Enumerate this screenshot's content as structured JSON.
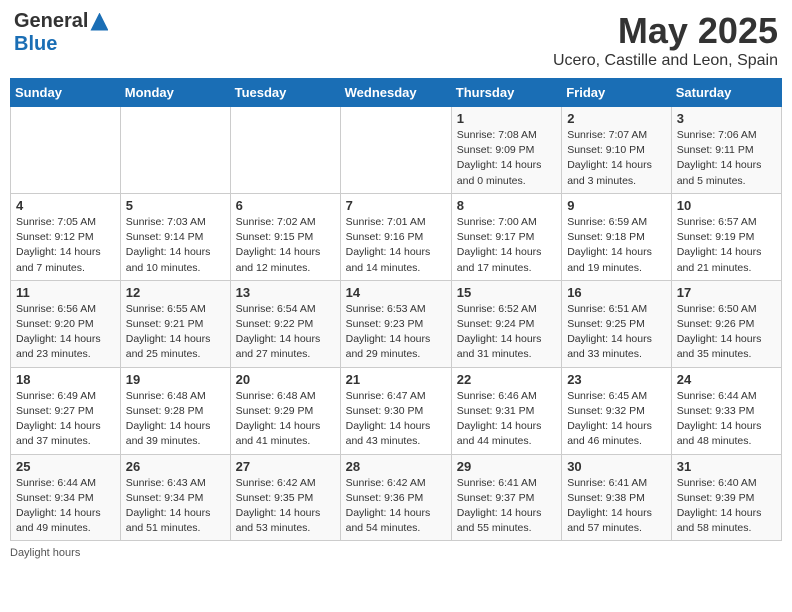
{
  "header": {
    "logo_general": "General",
    "logo_blue": "Blue",
    "month_title": "May 2025",
    "location": "Ucero, Castille and Leon, Spain"
  },
  "days_of_week": [
    "Sunday",
    "Monday",
    "Tuesday",
    "Wednesday",
    "Thursday",
    "Friday",
    "Saturday"
  ],
  "weeks": [
    [
      {
        "num": "",
        "info": ""
      },
      {
        "num": "",
        "info": ""
      },
      {
        "num": "",
        "info": ""
      },
      {
        "num": "",
        "info": ""
      },
      {
        "num": "1",
        "info": "Sunrise: 7:08 AM\nSunset: 9:09 PM\nDaylight: 14 hours\nand 0 minutes."
      },
      {
        "num": "2",
        "info": "Sunrise: 7:07 AM\nSunset: 9:10 PM\nDaylight: 14 hours\nand 3 minutes."
      },
      {
        "num": "3",
        "info": "Sunrise: 7:06 AM\nSunset: 9:11 PM\nDaylight: 14 hours\nand 5 minutes."
      }
    ],
    [
      {
        "num": "4",
        "info": "Sunrise: 7:05 AM\nSunset: 9:12 PM\nDaylight: 14 hours\nand 7 minutes."
      },
      {
        "num": "5",
        "info": "Sunrise: 7:03 AM\nSunset: 9:14 PM\nDaylight: 14 hours\nand 10 minutes."
      },
      {
        "num": "6",
        "info": "Sunrise: 7:02 AM\nSunset: 9:15 PM\nDaylight: 14 hours\nand 12 minutes."
      },
      {
        "num": "7",
        "info": "Sunrise: 7:01 AM\nSunset: 9:16 PM\nDaylight: 14 hours\nand 14 minutes."
      },
      {
        "num": "8",
        "info": "Sunrise: 7:00 AM\nSunset: 9:17 PM\nDaylight: 14 hours\nand 17 minutes."
      },
      {
        "num": "9",
        "info": "Sunrise: 6:59 AM\nSunset: 9:18 PM\nDaylight: 14 hours\nand 19 minutes."
      },
      {
        "num": "10",
        "info": "Sunrise: 6:57 AM\nSunset: 9:19 PM\nDaylight: 14 hours\nand 21 minutes."
      }
    ],
    [
      {
        "num": "11",
        "info": "Sunrise: 6:56 AM\nSunset: 9:20 PM\nDaylight: 14 hours\nand 23 minutes."
      },
      {
        "num": "12",
        "info": "Sunrise: 6:55 AM\nSunset: 9:21 PM\nDaylight: 14 hours\nand 25 minutes."
      },
      {
        "num": "13",
        "info": "Sunrise: 6:54 AM\nSunset: 9:22 PM\nDaylight: 14 hours\nand 27 minutes."
      },
      {
        "num": "14",
        "info": "Sunrise: 6:53 AM\nSunset: 9:23 PM\nDaylight: 14 hours\nand 29 minutes."
      },
      {
        "num": "15",
        "info": "Sunrise: 6:52 AM\nSunset: 9:24 PM\nDaylight: 14 hours\nand 31 minutes."
      },
      {
        "num": "16",
        "info": "Sunrise: 6:51 AM\nSunset: 9:25 PM\nDaylight: 14 hours\nand 33 minutes."
      },
      {
        "num": "17",
        "info": "Sunrise: 6:50 AM\nSunset: 9:26 PM\nDaylight: 14 hours\nand 35 minutes."
      }
    ],
    [
      {
        "num": "18",
        "info": "Sunrise: 6:49 AM\nSunset: 9:27 PM\nDaylight: 14 hours\nand 37 minutes."
      },
      {
        "num": "19",
        "info": "Sunrise: 6:48 AM\nSunset: 9:28 PM\nDaylight: 14 hours\nand 39 minutes."
      },
      {
        "num": "20",
        "info": "Sunrise: 6:48 AM\nSunset: 9:29 PM\nDaylight: 14 hours\nand 41 minutes."
      },
      {
        "num": "21",
        "info": "Sunrise: 6:47 AM\nSunset: 9:30 PM\nDaylight: 14 hours\nand 43 minutes."
      },
      {
        "num": "22",
        "info": "Sunrise: 6:46 AM\nSunset: 9:31 PM\nDaylight: 14 hours\nand 44 minutes."
      },
      {
        "num": "23",
        "info": "Sunrise: 6:45 AM\nSunset: 9:32 PM\nDaylight: 14 hours\nand 46 minutes."
      },
      {
        "num": "24",
        "info": "Sunrise: 6:44 AM\nSunset: 9:33 PM\nDaylight: 14 hours\nand 48 minutes."
      }
    ],
    [
      {
        "num": "25",
        "info": "Sunrise: 6:44 AM\nSunset: 9:34 PM\nDaylight: 14 hours\nand 49 minutes."
      },
      {
        "num": "26",
        "info": "Sunrise: 6:43 AM\nSunset: 9:34 PM\nDaylight: 14 hours\nand 51 minutes."
      },
      {
        "num": "27",
        "info": "Sunrise: 6:42 AM\nSunset: 9:35 PM\nDaylight: 14 hours\nand 53 minutes."
      },
      {
        "num": "28",
        "info": "Sunrise: 6:42 AM\nSunset: 9:36 PM\nDaylight: 14 hours\nand 54 minutes."
      },
      {
        "num": "29",
        "info": "Sunrise: 6:41 AM\nSunset: 9:37 PM\nDaylight: 14 hours\nand 55 minutes."
      },
      {
        "num": "30",
        "info": "Sunrise: 6:41 AM\nSunset: 9:38 PM\nDaylight: 14 hours\nand 57 minutes."
      },
      {
        "num": "31",
        "info": "Sunrise: 6:40 AM\nSunset: 9:39 PM\nDaylight: 14 hours\nand 58 minutes."
      }
    ]
  ],
  "footer": {
    "note": "Daylight hours"
  }
}
